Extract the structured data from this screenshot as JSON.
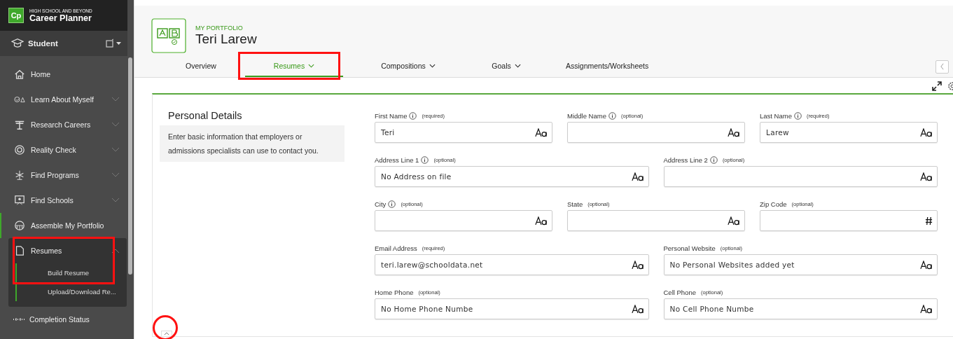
{
  "app": {
    "subtitle": "HIGH SCHOOL AND BEYOND",
    "title": "Career Planner",
    "logo": "Cp"
  },
  "role": {
    "label": "Student"
  },
  "sidebar": {
    "items": [
      {
        "label": "Home",
        "active": false
      },
      {
        "label": "Learn About Myself",
        "active": false,
        "expanded": false
      },
      {
        "label": "Research Careers",
        "active": false,
        "expanded": false
      },
      {
        "label": "Reality Check",
        "active": false,
        "expanded": false
      },
      {
        "label": "Find Programs",
        "active": false,
        "expanded": false
      },
      {
        "label": "Find Schools",
        "active": false,
        "expanded": false
      },
      {
        "label": "Assemble My Portfolio",
        "active": true
      },
      {
        "label": "Resumes",
        "active": false,
        "expanded": true,
        "highlighted": true,
        "children": [
          {
            "label": "Build Resume"
          },
          {
            "label": "Upload/Download Re..."
          }
        ]
      },
      {
        "label": "Completion Status",
        "active": false
      }
    ]
  },
  "header": {
    "eyebrow": "MY PORTFOLIO",
    "title": "Teri Larew"
  },
  "tabs": [
    {
      "label": "Overview",
      "selected": false,
      "dropdown": false,
      "highlighted": false
    },
    {
      "label": "Resumes",
      "selected": true,
      "dropdown": true,
      "highlighted": true
    },
    {
      "label": "Compositions",
      "selected": false,
      "dropdown": true,
      "highlighted": false
    },
    {
      "label": "Goals",
      "selected": false,
      "dropdown": true,
      "highlighted": false
    },
    {
      "label": "Assignments/Worksheets",
      "selected": false,
      "dropdown": false,
      "highlighted": false
    }
  ],
  "section": {
    "title": "Personal Details",
    "description": "Enter basic information that employers or admissions specialists can use to contact you.",
    "collapse_highlighted": true
  },
  "field_rows": [
    [
      {
        "label": "First Name",
        "info": true,
        "note": "(required)",
        "value": "Teri",
        "kind": "text"
      },
      {
        "label": "Middle Name",
        "info": true,
        "note": "(optional)",
        "kind": "text"
      },
      {
        "label": "Last Name",
        "info": true,
        "note": "(required)",
        "value": "Larew",
        "kind": "text"
      }
    ],
    [
      {
        "label": "Address Line 1",
        "info": true,
        "note": "(optional)",
        "value": "No Address on file",
        "kind": "text"
      },
      {
        "label": "Address Line 2",
        "info": true,
        "note": "(optional)",
        "kind": "text"
      }
    ],
    [
      {
        "label": "City",
        "info": true,
        "note": "(optional)",
        "kind": "text"
      },
      {
        "label": "State",
        "info": false,
        "note": "(optional)",
        "kind": "text"
      },
      {
        "label": "Zip Code",
        "info": false,
        "note": "(optional)",
        "kind": "number"
      }
    ],
    [
      {
        "label": "Email Address",
        "info": false,
        "note": "(required)",
        "value": "teri.larew@schooldata.net",
        "kind": "text"
      },
      {
        "label": "Personal Website",
        "info": false,
        "note": "(optional)",
        "value": "No Personal Websites added yet",
        "kind": "text"
      }
    ],
    [
      {
        "label": "Home Phone",
        "info": false,
        "note": "(optional)",
        "value": "No Home Phone Numbe",
        "kind": "text"
      },
      {
        "label": "Cell Phone",
        "info": false,
        "note": "(optional)",
        "value": "No Cell Phone Numbe",
        "kind": "text"
      }
    ]
  ]
}
